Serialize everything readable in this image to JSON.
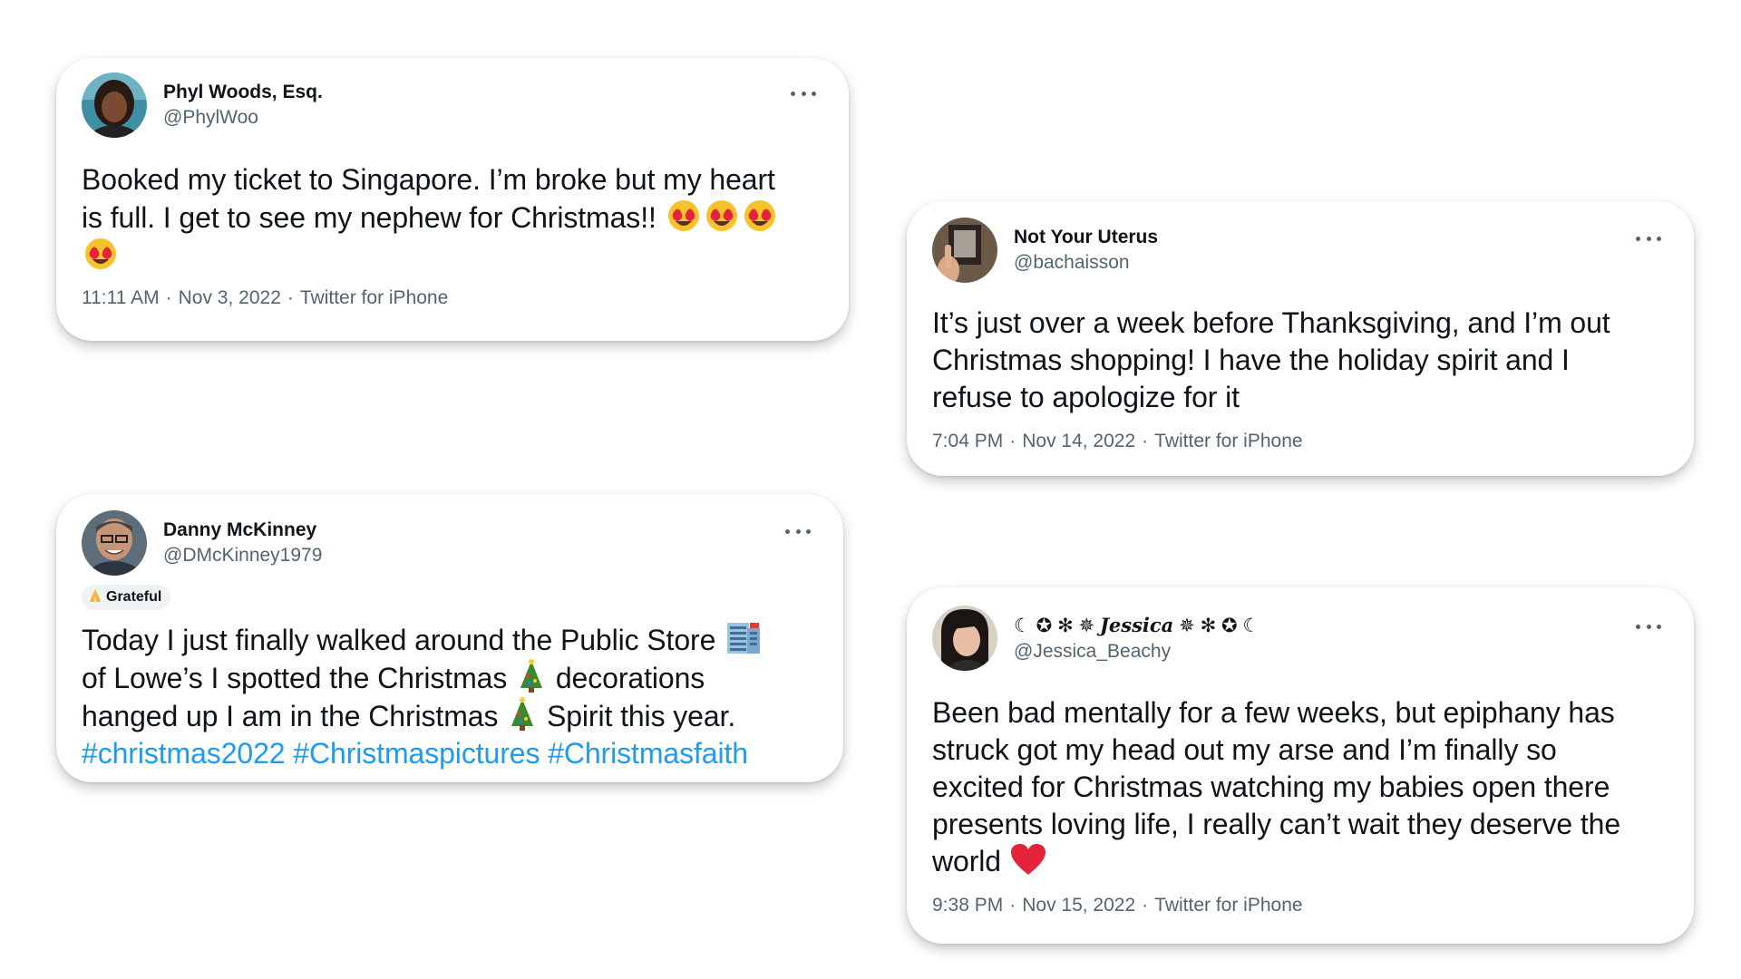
{
  "tweets": [
    {
      "display_name": "Phyl Woods, Esq.",
      "handle": "@PhylWoo",
      "text_1": "Booked my ticket to Singapore. I’m broke but my heart",
      "text_2": "is full. I get to see my nephew for Christmas!!",
      "emoji": "smiling-face-with-heart-eyes",
      "time": "11:11 AM",
      "date": "Nov 3, 2022",
      "source": "Twitter for iPhone",
      "separator": "·"
    },
    {
      "display_name": "Not Your Uterus",
      "handle": "@bachaisson",
      "text_1": "It’s just over a week before Thanksgiving, and I’m out",
      "text_2": "Christmas shopping! I have the holiday spirit and I",
      "text_3": "refuse to apologize for it",
      "time": "7:04 PM",
      "date": "Nov 14, 2022",
      "source": "Twitter for iPhone",
      "separator": "·"
    },
    {
      "display_name": "Danny McKinney",
      "handle": "@DMcKinney1979",
      "badge": "Grateful",
      "text_1a": "Today I just finally walked around the Public Store",
      "text_2a": "of Lowe’s I spotted the Christmas",
      "text_2b": "decorations",
      "text_3a": "hanged up I am in the Christmas",
      "text_3b": "Spirit this year.",
      "hashtags": [
        "#christmas2022",
        "#Christmaspictures",
        "#Christmasfaith"
      ]
    },
    {
      "display_name_left": "☾ ✪ ✻ ✵",
      "display_name_script": "Jessica",
      "display_name_right": "✵ ✻ ✪ ☾",
      "handle": "@Jessica_Beachy",
      "text_1": "Been bad mentally for a few weeks, but epiphany has",
      "text_2": "struck got my head out my arse and I’m finally so",
      "text_3": "excited for Christmas watching my babies open there",
      "text_4": "presents loving life, I really can’t wait they deserve the",
      "text_5": "world",
      "emoji": "red-heart",
      "time": "9:38 PM",
      "date": "Nov 15, 2022",
      "source": "Twitter for iPhone",
      "separator": "·"
    }
  ],
  "icons": {
    "more": "more-horizontal-icon",
    "heart_eyes": "heart-eyes-emoji",
    "tree": "christmas-tree-emoji",
    "building": "office-building-emoji",
    "heart": "red-heart-emoji",
    "praying_hands": "praying-hands-emoji"
  },
  "colors": {
    "text": "#0f1419",
    "muted": "#536471",
    "link": "#1d9bf0",
    "badge_bg": "#eff3f4"
  }
}
